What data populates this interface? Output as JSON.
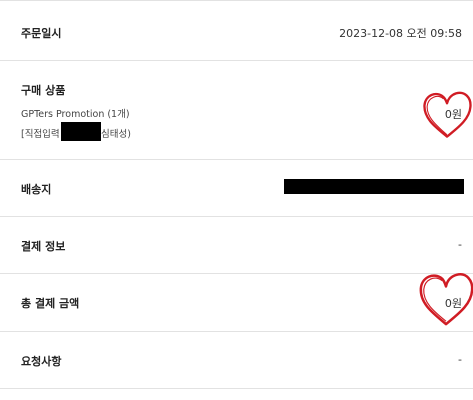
{
  "order_date": {
    "label": "주문일시",
    "value": "2023-12-08 오전 09:58"
  },
  "product": {
    "label": "구매 상품",
    "name": "GPTers Promotion (1개)",
    "option_prefix": "[직접입력",
    "option_suffix": "심태성)",
    "price": "0원"
  },
  "shipping": {
    "label": "배송지"
  },
  "payment_info": {
    "label": "결제 정보",
    "value": "-"
  },
  "total": {
    "label": "총 결제 금액",
    "value": "0원"
  },
  "request": {
    "label": "요청사항",
    "value": "-"
  },
  "annotations": {
    "heart_color": "#d01c24",
    "heart_icon": "heart-outline-icon"
  }
}
